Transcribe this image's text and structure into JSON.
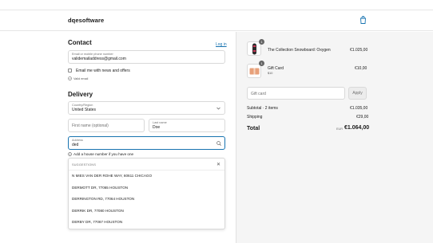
{
  "brand": "dqesoftware",
  "contact": {
    "title": "Contact",
    "login_link": "Log in",
    "email_label": "Email or mobile phone number",
    "email_value": "validemailaddress@gmail.com",
    "newsletter_label": "Email me with news and offers",
    "valid_text": "Valid email"
  },
  "delivery": {
    "title": "Delivery",
    "country_label": "Country/Region",
    "country_value": "United States",
    "first_name_placeholder": "First name (optional)",
    "last_name_label": "Last name",
    "last_name_value": "Doe",
    "address_label": "Address",
    "address_value": "ded",
    "address_hint": "Add a house number if you have one"
  },
  "suggestions": {
    "header": "SUGGESTIONS",
    "items": [
      "N MIES VAN DER ROHE WAY, 60611 CHICAGO",
      "DERMOTT DR, 77065 HOUSTON",
      "DERRINGTON RD, 77064 HOUSTON",
      "DERRIK DR, 77080 HOUSTON",
      "DERBY DR, 77067 HOUSTON"
    ]
  },
  "summary": {
    "items": [
      {
        "qty": "1",
        "name": "The Collection Snowboard: Oxygen",
        "variant": "",
        "price": "€1.025,00"
      },
      {
        "qty": "1",
        "name": "Gift Card",
        "variant": "$10",
        "price": "€10,00"
      }
    ],
    "discount_placeholder": "Gift card",
    "apply_label": "Apply",
    "subtotal_label": "Subtotal · 2 items",
    "subtotal_value": "€1.035,00",
    "shipping_label": "Shipping",
    "shipping_value": "€29,00",
    "total_label": "Total",
    "total_currency": "EUR",
    "total_value": "€1.064,00"
  },
  "colors": {
    "accent": "#1773b0",
    "panel": "#f5f5f5"
  },
  "icons": [
    "bag-icon",
    "chevron-down-icon",
    "search-icon",
    "info-icon",
    "close-icon",
    "check-icon"
  ]
}
